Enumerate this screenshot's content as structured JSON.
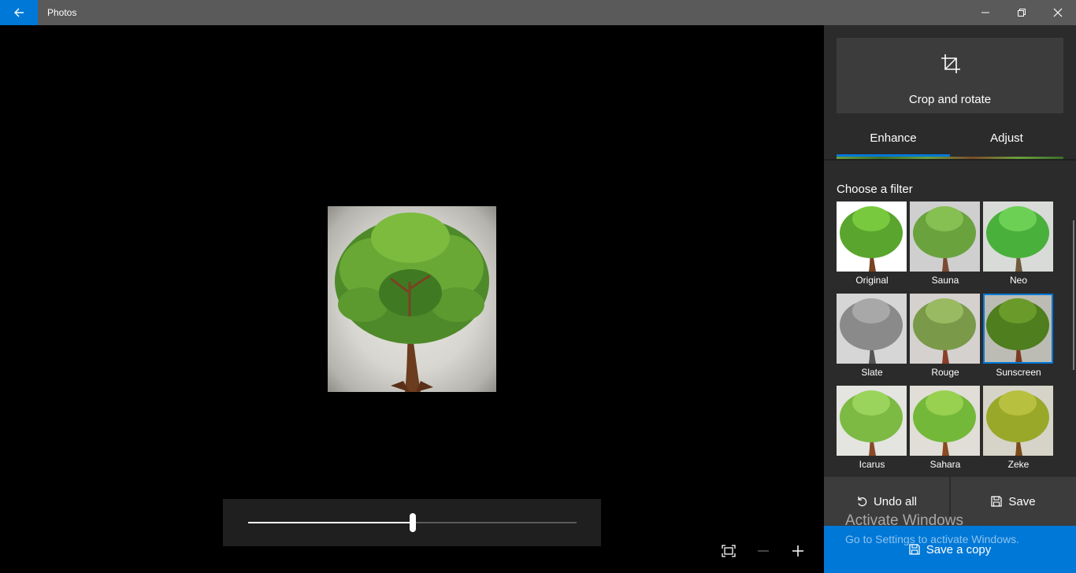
{
  "app": {
    "title": "Photos"
  },
  "colors": {
    "accent": "#0078d7",
    "titlebar": "#5a5a5a",
    "panel": "#2b2b2b",
    "button": "#3c3c3c"
  },
  "titlebar_icons": {
    "back": "back-arrow-icon",
    "minimize": "minimize-icon",
    "maximize": "restore-icon",
    "close": "close-icon"
  },
  "editor": {
    "crop": {
      "label": "Crop and rotate",
      "icon": "crop-icon"
    },
    "tabs": [
      {
        "label": "Enhance",
        "selected": true
      },
      {
        "label": "Adjust",
        "selected": false
      }
    ],
    "filters_heading": "Choose a filter",
    "filters": [
      {
        "name": "Original",
        "selected": false
      },
      {
        "name": "Sauna",
        "selected": false
      },
      {
        "name": "Neo",
        "selected": false
      },
      {
        "name": "Slate",
        "selected": false
      },
      {
        "name": "Rouge",
        "selected": false
      },
      {
        "name": "Sunscreen",
        "selected": true
      },
      {
        "name": "Icarus",
        "selected": false
      },
      {
        "name": "Sahara",
        "selected": false
      },
      {
        "name": "Zeke",
        "selected": false
      }
    ],
    "actions": {
      "undo_all": "Undo all",
      "save": "Save",
      "save_copy": "Save a copy"
    },
    "filter_intensity": 0.5
  },
  "watermark": {
    "title": "Activate Windows",
    "subtitle": "Go to Settings to activate Windows."
  }
}
